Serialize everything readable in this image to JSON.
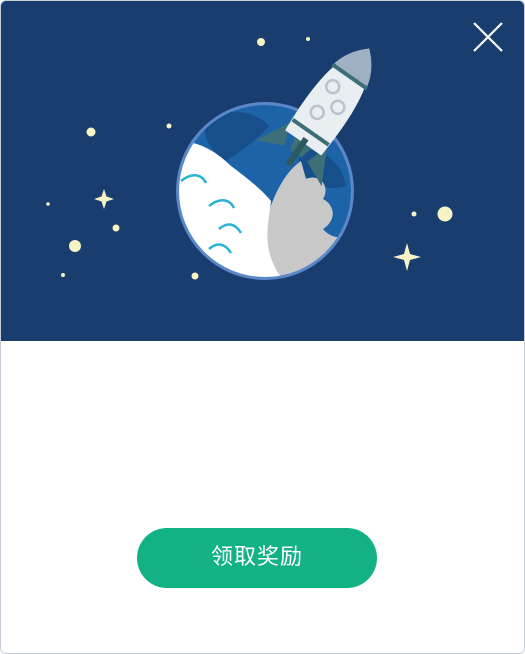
{
  "dialog": {
    "banner": {
      "illustration": "rocket-launch-from-planet",
      "background_color": "#183d6e"
    },
    "close_icon": "close-icon",
    "claim_button": {
      "label": "领取奖励",
      "color": "#12b284"
    }
  }
}
